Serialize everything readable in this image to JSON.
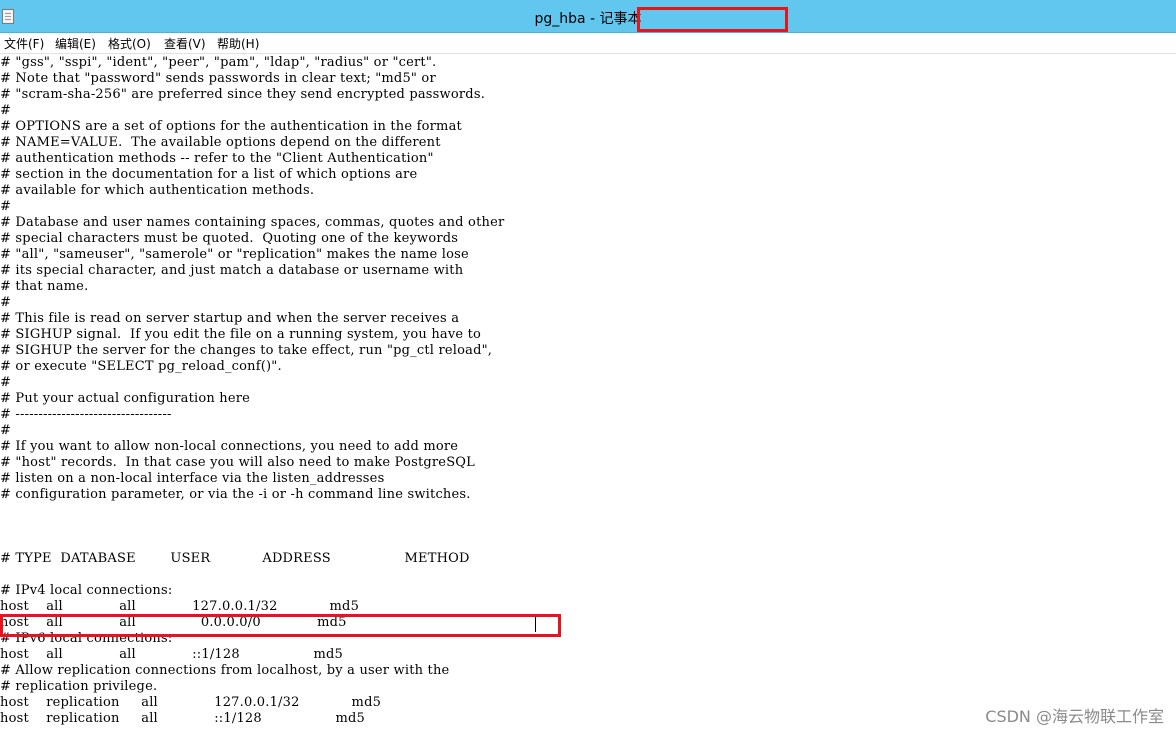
{
  "window": {
    "title": "pg_hba - 记事本"
  },
  "menu": {
    "items": [
      "文件(F)",
      "编辑(E)",
      "格式(O)",
      "查看(V)",
      "帮助(H)"
    ]
  },
  "editor": {
    "content": "# \"gss\", \"sspi\", \"ident\", \"peer\", \"pam\", \"ldap\", \"radius\" or \"cert\".\n# Note that \"password\" sends passwords in clear text; \"md5\" or\n# \"scram-sha-256\" are preferred since they send encrypted passwords.\n#\n# OPTIONS are a set of options for the authentication in the format\n# NAME=VALUE.  The available options depend on the different\n# authentication methods -- refer to the \"Client Authentication\"\n# section in the documentation for a list of which options are\n# available for which authentication methods.\n#\n# Database and user names containing spaces, commas, quotes and other\n# special characters must be quoted.  Quoting one of the keywords\n# \"all\", \"sameuser\", \"samerole\" or \"replication\" makes the name lose\n# its special character, and just match a database or username with\n# that name.\n#\n# This file is read on server startup and when the server receives a\n# SIGHUP signal.  If you edit the file on a running system, you have to\n# SIGHUP the server for the changes to take effect, run \"pg_ctl reload\",\n# or execute \"SELECT pg_reload_conf()\".\n#\n# Put your actual configuration here\n# ----------------------------------\n#\n# If you want to allow non-local connections, you need to add more\n# \"host\" records.  In that case you will also need to make PostgreSQL\n# listen on a non-local interface via the listen_addresses\n# configuration parameter, or via the -i or -h command line switches.\n\n\n\n# TYPE  DATABASE        USER            ADDRESS                 METHOD\n\n# IPv4 local connections:\nhost    all             all             127.0.0.1/32            md5\nhost    all             all               0.0.0.0/0             md5\n# IPv6 local connections:\nhost    all             all             ::1/128                 md5\n# Allow replication connections from localhost, by a user with the\n# replication privilege.\nhost    replication     all             127.0.0.1/32            md5\nhost    replication     all             ::1/128                 md5"
  },
  "watermark": "CSDN @海云物联工作室",
  "colors": {
    "titlebar": "#62c7ee",
    "highlight": "#e5161b"
  }
}
